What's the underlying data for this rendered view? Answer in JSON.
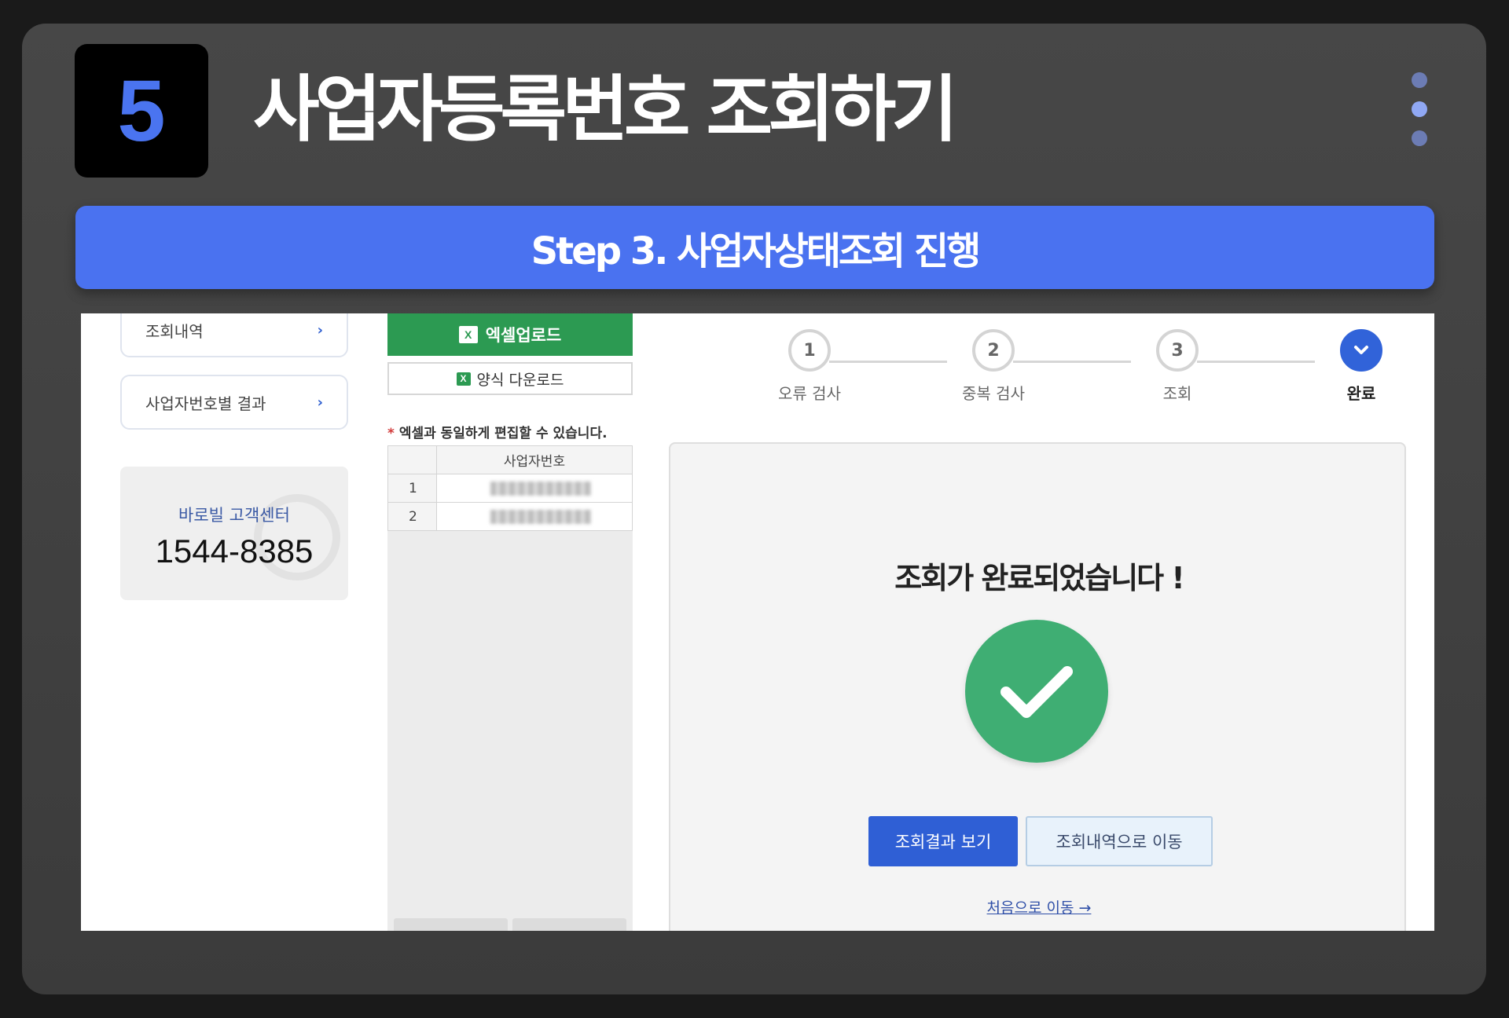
{
  "header": {
    "step_number": "5",
    "title": "사업자등록번호 조회하기"
  },
  "pager": {
    "count": 3,
    "active_index": 1
  },
  "banner": {
    "text": "Step 3. 사업자상태조회 진행"
  },
  "sidebar": {
    "items": [
      {
        "label": "조회내역",
        "chevron": "›"
      },
      {
        "label": "사업자번호별 결과",
        "chevron": "›"
      }
    ],
    "support": {
      "label": "바로빌 고객센터",
      "phone": "1544-8385",
      "icon": "headset-icon"
    }
  },
  "upload": {
    "excel_upload_label": "엑셀업로드",
    "form_download_label": "양식 다운로드",
    "edit_note_star": "*",
    "edit_note": "엑셀과 동일하게 편집할 수 있습니다.",
    "table": {
      "column_header": "사업자번호",
      "rows": [
        {
          "index": "1"
        },
        {
          "index": "2"
        }
      ]
    }
  },
  "progress": {
    "steps": [
      {
        "number": "1",
        "label": "오류 검사"
      },
      {
        "number": "2",
        "label": "중복 검사"
      },
      {
        "number": "3",
        "label": "조회"
      },
      {
        "number": "",
        "label": "완료",
        "state": "done",
        "icon": "chevron-down-icon"
      }
    ]
  },
  "result": {
    "message": "조회가 완료되었습니다 !",
    "icon": "check-icon",
    "view_button": "조회결과 보기",
    "history_button": "조회내역으로 이동",
    "home_link": "처음으로 이동 →"
  },
  "colors": {
    "accent": "#4a72f0",
    "excel_green": "#2c9a52",
    "check_green": "#3fae73",
    "primary_button": "#2f5fd5"
  }
}
